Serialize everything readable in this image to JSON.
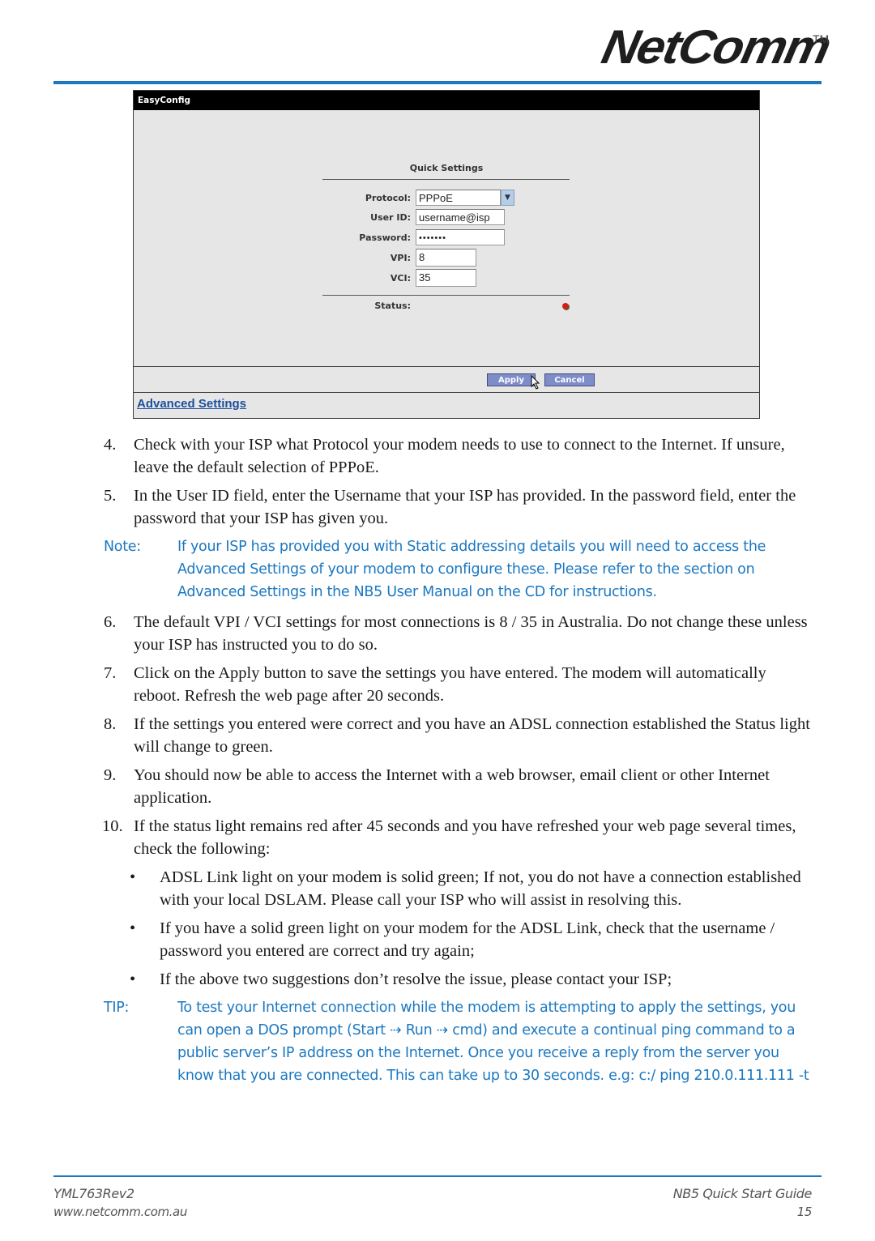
{
  "header": {
    "brand": "NetComm",
    "trademark": "TM",
    "accent_color": "#1b78c1"
  },
  "screenshot": {
    "title": "EasyConfig",
    "section_title": "Quick Settings",
    "fields": {
      "protocol": {
        "label": "Protocol:",
        "value": "PPPoE"
      },
      "user_id": {
        "label": "User ID:",
        "value": "username@isp"
      },
      "password": {
        "label": "Password:",
        "value": "•••••••"
      },
      "vpi": {
        "label": "VPI:",
        "value": "8"
      },
      "vci": {
        "label": "VCI:",
        "value": "35"
      }
    },
    "status": {
      "label": "Status:",
      "state": "red"
    },
    "buttons": {
      "apply": "Apply",
      "cancel": "Cancel"
    },
    "advanced_link": "Advanced Settings"
  },
  "steps": [
    {
      "num": "4.",
      "text": "Check with your ISP what Protocol your modem needs to use to connect to the Internet. If unsure, leave the default selection of PPPoE."
    },
    {
      "num": "5.",
      "text": "In the User ID field, enter the Username that your ISP has provided. In the password field, enter the password that your ISP has given you."
    },
    {
      "num": "6.",
      "text": "The default VPI / VCI settings for most connections is 8 / 35 in Australia. Do not change these unless your ISP has instructed you to do so."
    },
    {
      "num": "7.",
      "text": "Click on the Apply button to save the settings you have entered. The modem will automatically reboot. Refresh the web page after 20 seconds."
    },
    {
      "num": "8.",
      "text": "If the settings you entered were correct and you have an ADSL connection established the Status light will change to green."
    },
    {
      "num": "9.",
      "text": "You should now be able to access the Internet with a web browser, email client or other Internet application."
    },
    {
      "num": "10.",
      "text": "If the status light remains red after 45 seconds and you have refreshed your web page several times, check the following:"
    }
  ],
  "note": {
    "tag": "Note:",
    "text": "If your ISP has provided you with Static addressing details you will need to access the Advanced Settings of your modem to configure these. Please refer to the section on Advanced Settings in the NB5 User Manual on the CD for instructions."
  },
  "bullets": [
    "ADSL Link light on your modem is solid green; If not, you do not have a connection established with your local DSLAM. Please call your ISP who will assist in resolving this.",
    "If you have a solid green light on your modem for the ADSL Link, check that the username / password you entered are correct and try again;",
    "If the above two suggestions don’t resolve the issue, please contact your ISP;"
  ],
  "tip": {
    "tag": "TIP:",
    "text": "To test your Internet connection while the modem is attempting to apply the settings, you can open a DOS prompt (Start ⇢ Run ⇢ cmd) and execute a continual ping command to a public server’s IP address on the Internet. Once you receive a reply from the server you know that you are connected. This can take up to 30 seconds. e.g:  c:/  ping 210.0.111.111 -t"
  },
  "footer": {
    "doc_id": "YML763Rev2",
    "website": "www.netcomm.com.au",
    "guide_title": "NB5 Quick Start Guide",
    "page_number": "15"
  }
}
